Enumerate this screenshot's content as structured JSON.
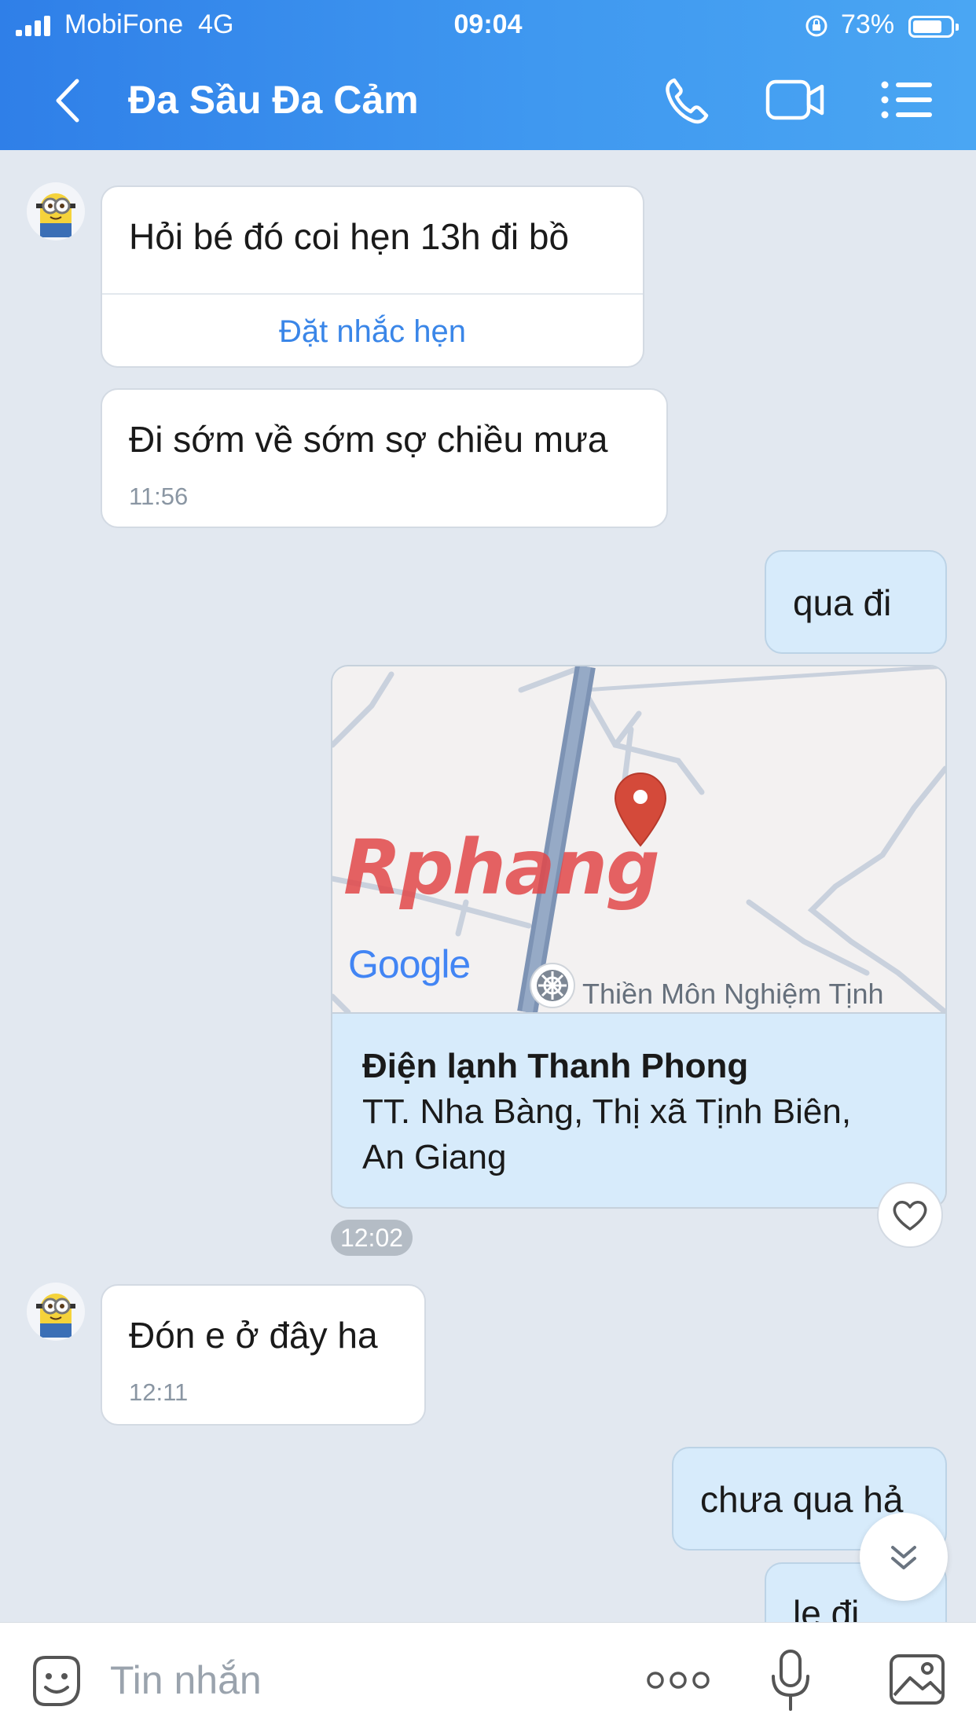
{
  "status_bar": {
    "carrier": "MobiFone",
    "network": "4G",
    "time": "09:04",
    "battery_pct": "73%"
  },
  "header": {
    "title": "Đa Sầu Đa Cảm",
    "icons": [
      "back-icon",
      "phone-icon",
      "video-call-icon",
      "menu-icon"
    ]
  },
  "messages": {
    "m1": {
      "text": "Hỏi bé đó coi hẹn 13h đi bồ",
      "action": "Đặt nhắc hẹn"
    },
    "m2": {
      "text": "Đi sớm về sớm sợ chiều mưa",
      "time": "11:56"
    },
    "m3": {
      "text": "qua đi"
    },
    "location": {
      "name": "Điện lạnh Thanh Phong",
      "address_line1": "TT. Nha Bàng, Thị xã Tịnh Biên,",
      "address_line2": "An Giang",
      "map_logo": "Google",
      "map_place_label": "Thiền Môn Nghiệm Tịnh",
      "watermark": "Rphang",
      "time": "12:02"
    },
    "m4": {
      "text": "Đón e ở đây ha",
      "time": "12:11"
    },
    "m5": {
      "text": "chưa qua hả"
    },
    "m6": {
      "text": "le đi"
    }
  },
  "composer": {
    "placeholder": "Tin nhắn",
    "value": ""
  },
  "colors": {
    "header_start": "#2f7fe8",
    "header_end": "#4aa6f3",
    "chat_bg": "#e2e8f0",
    "outgoing_bubble": "#d7ebfb",
    "link_blue": "#3a86e8",
    "pin_red": "#d44a3a"
  }
}
